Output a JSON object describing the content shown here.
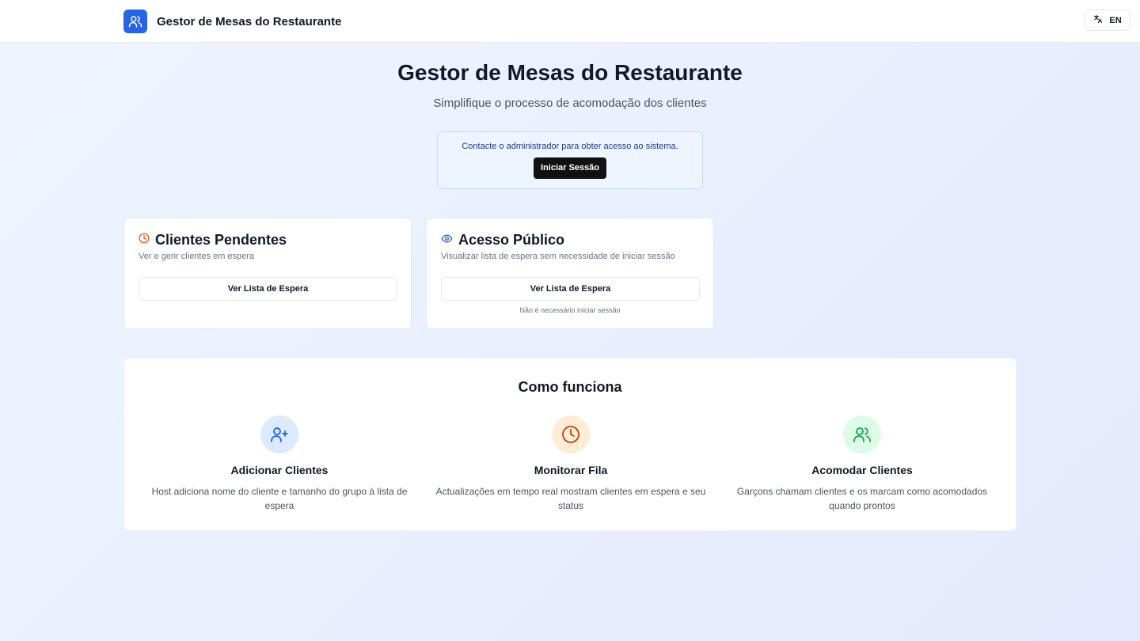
{
  "header": {
    "title": "Gestor de Mesas do Restaurante",
    "logo_icon": "users-icon",
    "language_label": "EN",
    "language_icon": "translate-icon"
  },
  "hero": {
    "title": "Gestor de Mesas do Restaurante",
    "subtitle": "Simplifique o processo de acomodação dos clientes"
  },
  "notice": {
    "text": "Contacte o administrador para obter acesso ao sistema.",
    "login_label": "Iniciar Sessão"
  },
  "cards": {
    "pending": {
      "icon": "clock-icon",
      "title": "Clientes Pendentes",
      "description": "Ver e gerir clientes em espera",
      "button_label": "Ver Lista de Espera"
    },
    "public": {
      "icon": "eye-icon",
      "title": "Acesso Público",
      "description": "Visualizar lista de espera sem necessidade de iniciar sessão",
      "button_label": "Ver Lista de Espera",
      "note": "Não é necessário iniciar sessão"
    }
  },
  "how_it_works": {
    "title": "Como funciona",
    "steps": [
      {
        "icon": "user-plus-icon",
        "title": "Adicionar Clientes",
        "description": "Host adiciona nome do cliente e tamanho do grupo à lista de espera",
        "circle_color": "#dbeafe",
        "icon_color": "#2563eb"
      },
      {
        "icon": "clock-icon",
        "title": "Monitorar Fila",
        "description": "Actualizações em tempo real mostram clientes em espera e seu status",
        "circle_color": "#ffedd5",
        "icon_color": "#c2410c"
      },
      {
        "icon": "users-icon",
        "title": "Acomodar Clientes",
        "description": "Garçons chamam clientes e os marcam como acomodados quando prontos",
        "circle_color": "#dcfce7",
        "icon_color": "#16a34a"
      }
    ]
  },
  "colors": {
    "brand": "#2563eb",
    "clock_accent": "#ea580c",
    "eye_accent": "#2563eb",
    "primary_button": "#111111"
  }
}
